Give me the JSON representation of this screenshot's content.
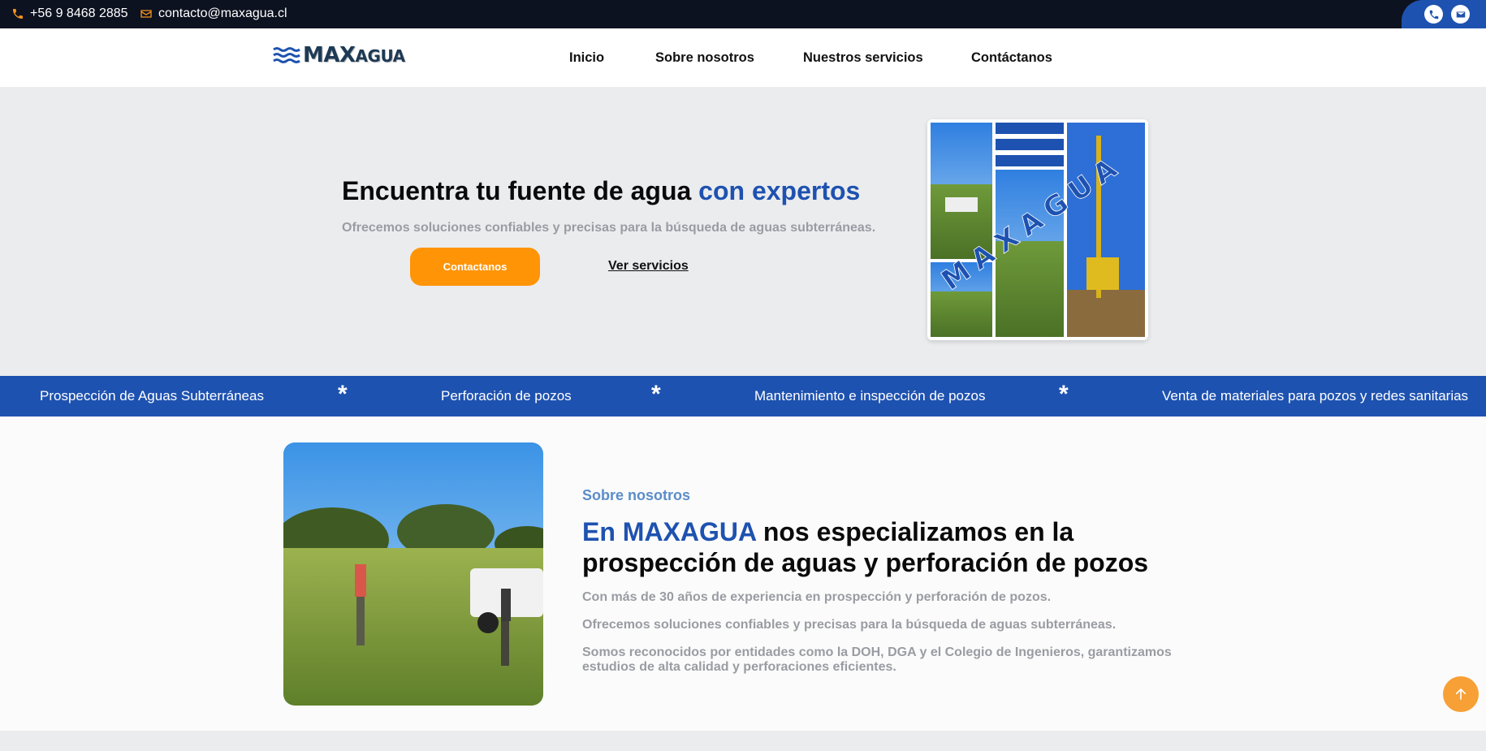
{
  "topbar": {
    "phone": "+56 9 8468 2885",
    "email": "contacto@maxagua.cl"
  },
  "logo": {
    "main": "MAX",
    "small": "AGUA"
  },
  "nav": {
    "items": [
      {
        "label": "Inicio"
      },
      {
        "label": "Sobre nosotros"
      },
      {
        "label": "Nuestros servicios"
      },
      {
        "label": "Contáctanos"
      }
    ]
  },
  "hero": {
    "title_plain": "Encuentra tu fuente de agua ",
    "title_accent": "con expertos",
    "subtitle": "Ofrecemos soluciones confiables y precisas para la búsqueda de aguas subterráneas.",
    "cta_label": "Contactanos",
    "link_label": "Ver servicios",
    "collage_text": "MAXAGUA"
  },
  "banner": {
    "items": [
      "Prospección de Aguas Subterráneas",
      "Perforación de pozos",
      "Mantenimiento e inspección de pozos",
      "Venta de materiales para pozos y redes sanitarias"
    ],
    "separator": "*"
  },
  "about": {
    "label": "Sobre nosotros",
    "title_accent": "En MAXAGUA",
    "title_rest": " nos especializamos en la prospección de aguas y perforación de pozos",
    "paragraphs": [
      "Con más de 30 años de experiencia en prospección y perforación de pozos.",
      "Ofrecemos soluciones confiables y precisas para la búsqueda de aguas subterráneas.",
      "Somos reconocidos por entidades como la DOH, DGA y el Colegio de Ingenieros, garantizamos estudios de alta calidad y perforaciones eficientes."
    ]
  },
  "colors": {
    "primary_blue": "#1e52b0",
    "orange": "#ff9407",
    "topbar_bg": "#0d1220",
    "muted_text": "#9a9ca3"
  },
  "icons": [
    "phone-icon",
    "envelope-icon",
    "arrow-up-icon"
  ]
}
